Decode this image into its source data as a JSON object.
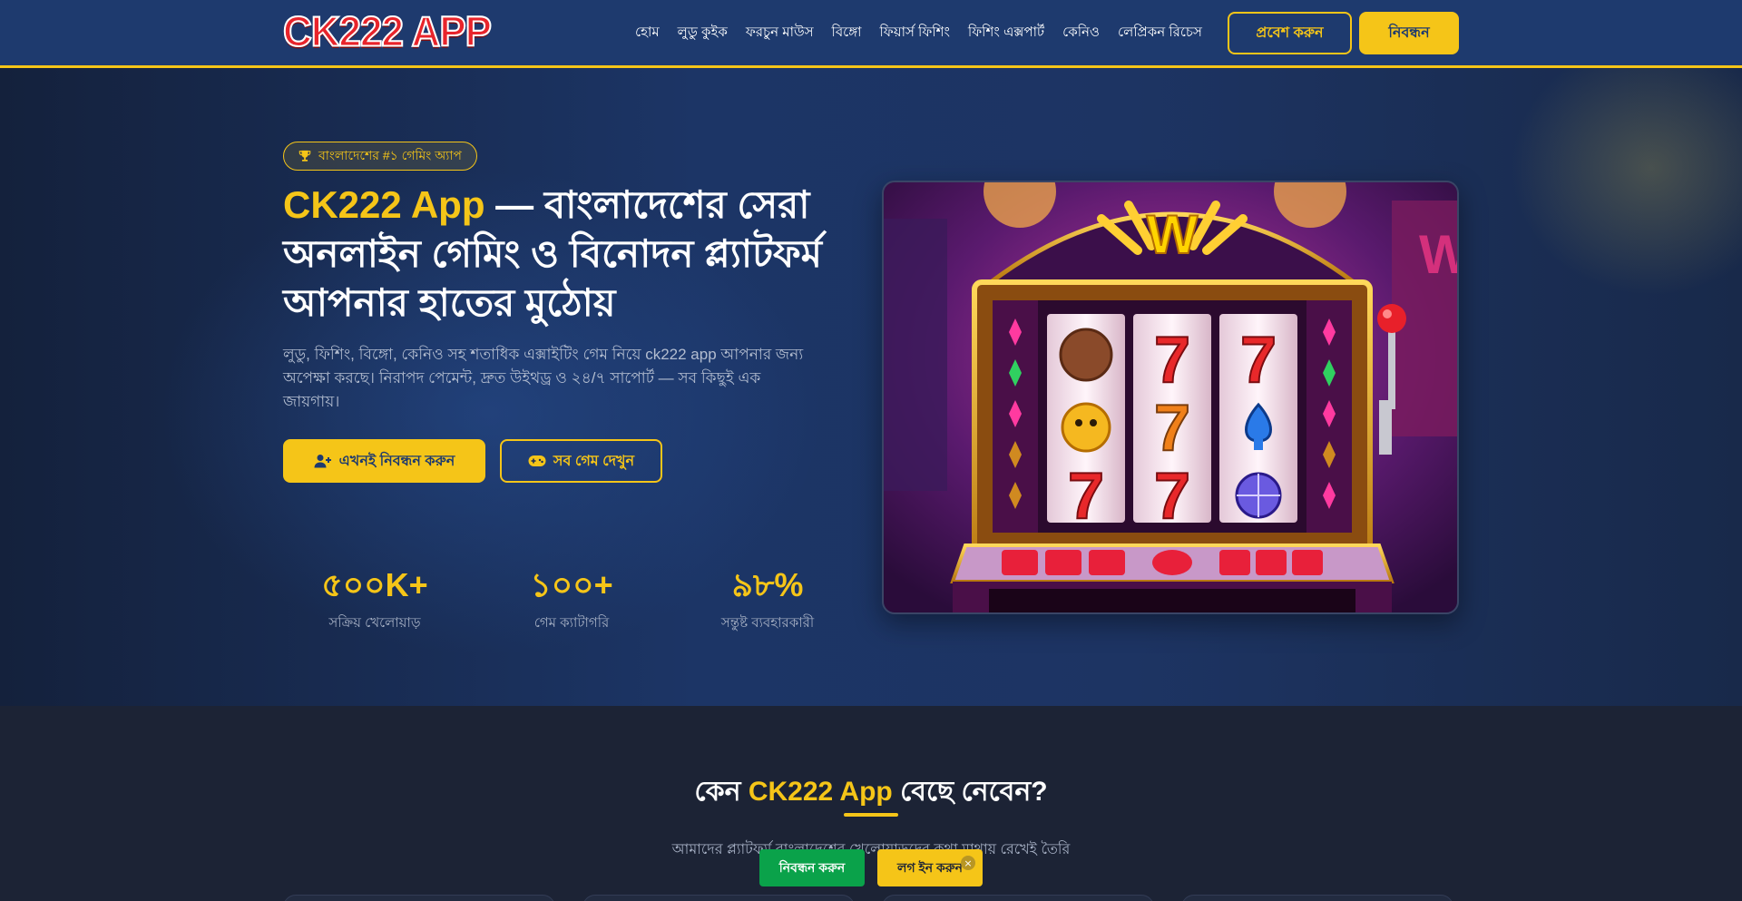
{
  "header": {
    "logo_text": "CK222 APP",
    "nav": [
      "হোম",
      "লুডু কুইক",
      "ফরচুন মাউস",
      "বিঙ্গো",
      "ফিয়ার্স ফিশিং",
      "ফিশিং এক্সপার্ট",
      "কেনিও",
      "লেপ্রিকন রিচেস"
    ],
    "login_label": "প্রবেশ করুন",
    "register_label": "নিবন্ধন"
  },
  "hero": {
    "badge": "বাংলাদেশের #১ গেমিং অ্যাপ",
    "title_accent": "CK222 App",
    "title_rest": " — বাংলাদেশের সেরা অনলাইন গেমিং ও বিনোদন প্ল্যাটফর্ম আপনার হাতের মুঠোয়",
    "description": "লুডু, ফিশিং, বিঙ্গো, কেনিও সহ শতাধিক এক্সাইটিং গেম নিয়ে ck222 app আপনার জন্য অপেক্ষা করছে। নিরাপদ পেমেন্ট, দ্রুত উইথড্র ও ২৪/৭ সাপোর্ট — সব কিছুই এক জায়গায়।",
    "cta_primary": "এখনই নিবন্ধন করুন",
    "cta_secondary": "সব গেম দেখুন",
    "stats": [
      {
        "value": "৫০০K+",
        "label": "সক্রিয় খেলোয়াড়"
      },
      {
        "value": "১০০+",
        "label": "গেম ক্যাটাগরি"
      },
      {
        "value": "৯৮%",
        "label": "সন্তুষ্ট ব্যবহারকারী"
      }
    ]
  },
  "section": {
    "title_pre": "কেন ",
    "title_accent": "CK222 App",
    "title_post": " বেছে নেবেন?",
    "subtitle": "আমাদের প্ল্যাটফর্ম বাংলাদেশের খেলোয়াড়দের কথা মাথায় রেখেই তৈরি"
  },
  "floating": {
    "register_label": "নিবন্ধন করুন",
    "login_label": "লগ ইন করুন",
    "close_label": "×"
  },
  "colors": {
    "accent": "#f5c518",
    "header_bg": "#1e3a6e",
    "green": "#0aa24a"
  },
  "icons": {
    "badge": "trophy-icon",
    "cta_primary": "user-plus-icon",
    "cta_secondary": "gamepad-icon"
  }
}
